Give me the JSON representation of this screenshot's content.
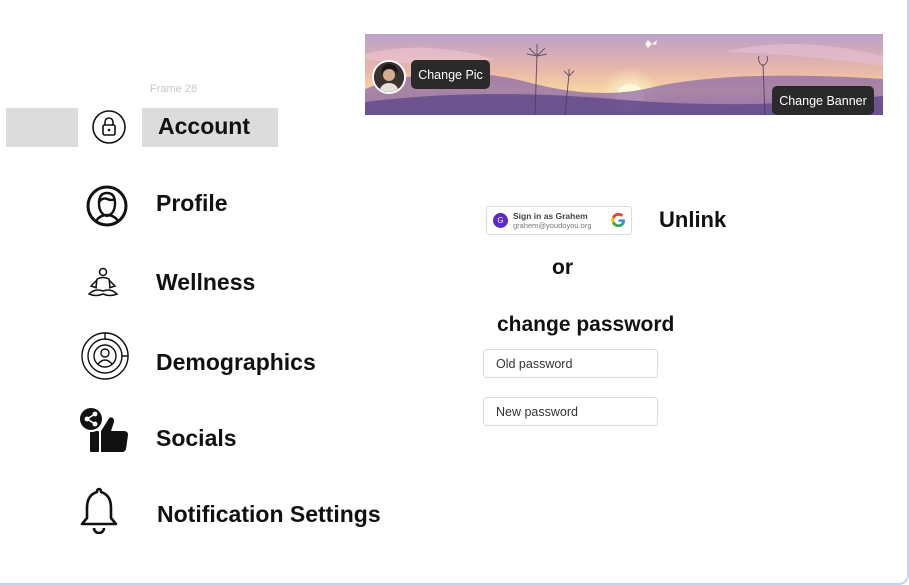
{
  "frame_label": "Frame 28",
  "sidebar": {
    "items": [
      {
        "label": "Account",
        "icon": "lock-icon",
        "selected": true
      },
      {
        "label": "Profile",
        "icon": "profile-face-icon"
      },
      {
        "label": "Wellness",
        "icon": "meditation-icon"
      },
      {
        "label": "Demographics",
        "icon": "demographics-chart-icon"
      },
      {
        "label": "Socials",
        "icon": "share-thumbs-up-icon"
      },
      {
        "label": "Notification Settings",
        "icon": "bell-icon"
      }
    ]
  },
  "banner": {
    "change_pic_label": "Change Pic",
    "change_banner_label": "Change Banner"
  },
  "google": {
    "avatar_letter": "G",
    "sign_in_text": "Sign in as Grahem",
    "email": "grahem@youdoyou.org"
  },
  "account": {
    "unlink_label": "Unlink",
    "or_text": "or",
    "change_password_heading": "change password",
    "old_password_placeholder": "Old password",
    "new_password_placeholder": "New password"
  },
  "colors": {
    "selected_bg": "#dcdcdc",
    "button_dark": "#2a2a2a",
    "google_avatar": "#5b2bc7"
  }
}
